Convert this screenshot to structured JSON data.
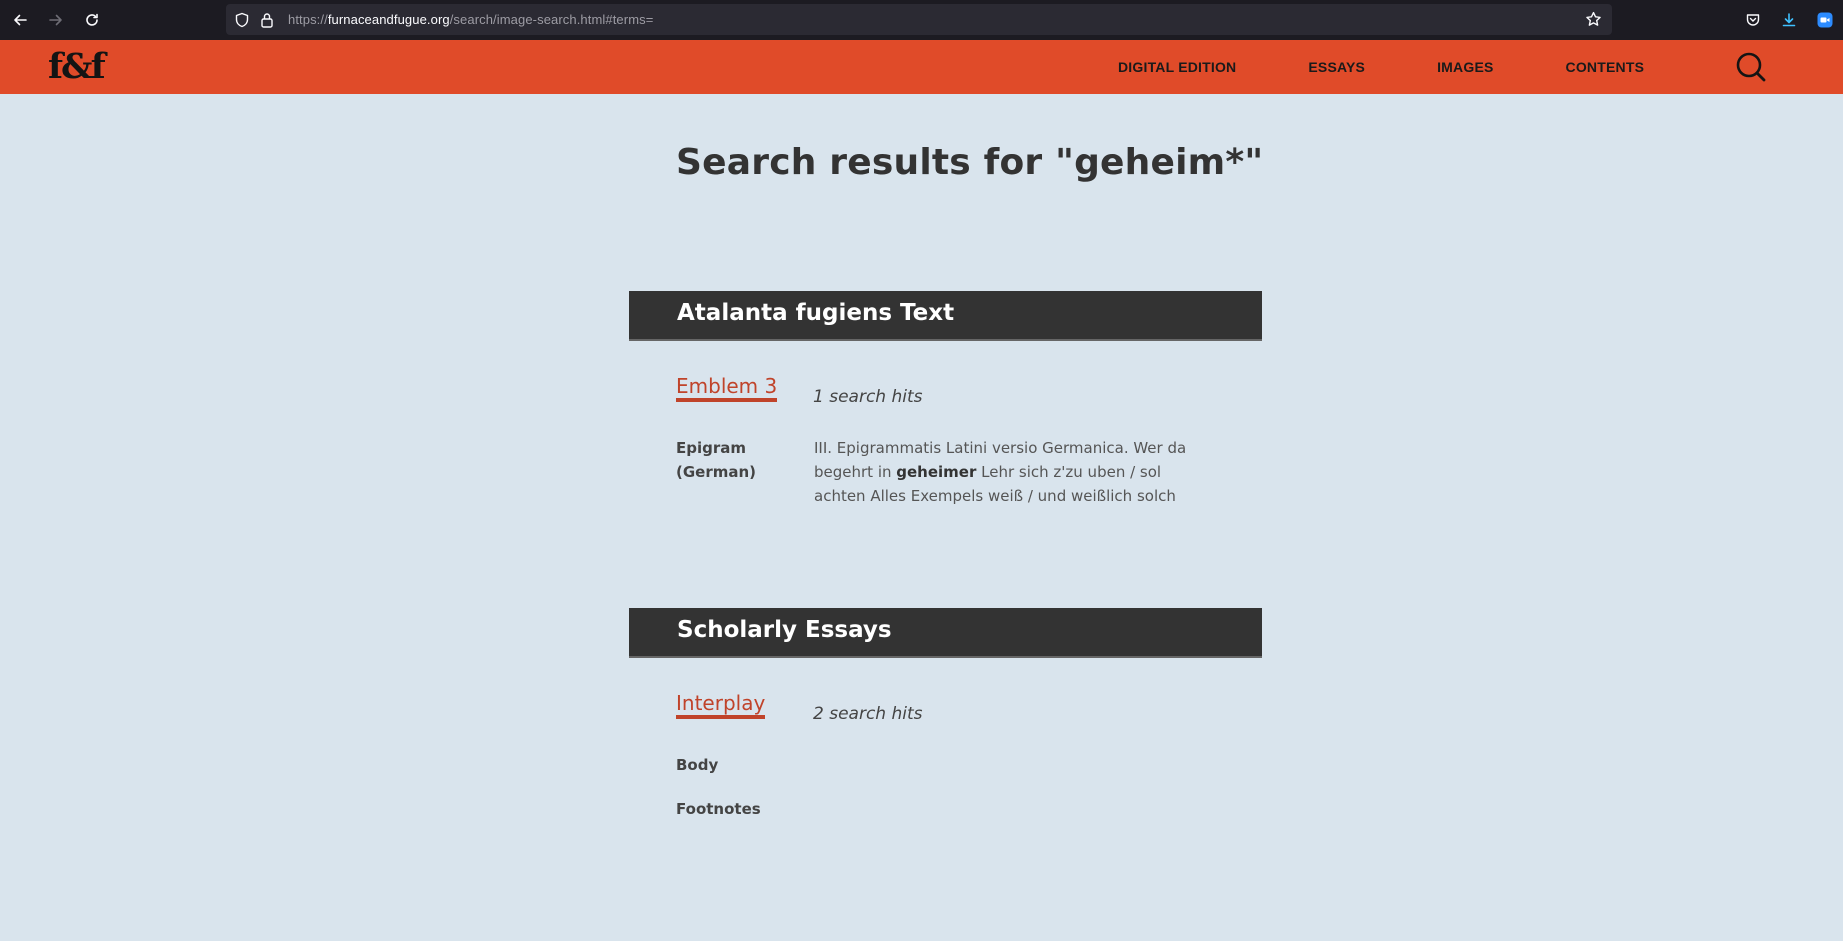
{
  "browser": {
    "url_scheme": "https://",
    "url_host": "furnaceandfugue.org",
    "url_path": "/search/image-search.html#terms="
  },
  "site": {
    "logo": "f&f",
    "nav": [
      "DIGITAL EDITION",
      "ESSAYS",
      "IMAGES",
      "CONTENTS"
    ],
    "accent_color": "#e04b29"
  },
  "page": {
    "title": "Search results for \"geheim*\""
  },
  "sections": [
    {
      "heading": "Atalanta fugiens Text",
      "results": [
        {
          "link": "Emblem 3",
          "hits": "1 search hits",
          "fields": [
            {
              "label": "Epigram (German)",
              "snippet_before": "III. Epigrammatis Latini versio Germanica. Wer da begehrt in ",
              "snippet_match": "geheimer",
              "snippet_after": " Lehr sich z'zu uben / sol achten Alles Exempels weiß / und weißlich solch"
            }
          ]
        }
      ]
    },
    {
      "heading": "Scholarly Essays",
      "results": [
        {
          "link": "Interplay",
          "hits": "2 search hits",
          "fields": [
            {
              "label": "Body"
            },
            {
              "label": "Footnotes"
            }
          ]
        }
      ]
    }
  ]
}
